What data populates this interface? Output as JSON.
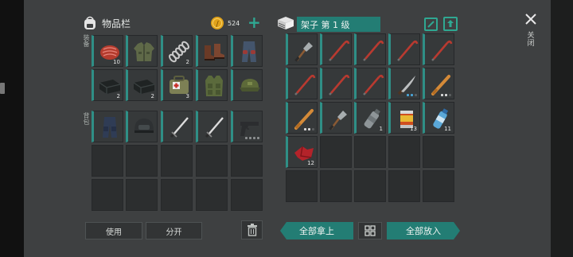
{
  "inventory": {
    "title": "物品栏",
    "coins": "524",
    "add_label": "+",
    "equip_label": "装备",
    "backpack_label": "背包",
    "equip_slots": [
      {
        "item": "raw-meat",
        "count": "10"
      },
      {
        "item": "jacket",
        "count": ""
      },
      {
        "item": "spring",
        "count": "2"
      },
      {
        "item": "boots",
        "count": ""
      },
      {
        "item": "pants",
        "count": ""
      },
      {
        "item": "cloth",
        "count": "2"
      },
      {
        "item": "cloth",
        "count": "2"
      },
      {
        "item": "first-aid-bag",
        "count": "3"
      },
      {
        "item": "vest",
        "count": ""
      },
      {
        "item": "cap",
        "count": ""
      }
    ],
    "backpack_slots": [
      {
        "item": "tactical-pants",
        "count": ""
      },
      {
        "item": "helmet",
        "count": ""
      },
      {
        "item": "katana",
        "count": ""
      },
      {
        "item": "katana",
        "count": ""
      },
      {
        "item": "pistol",
        "count": ""
      }
    ],
    "use_label": "使用",
    "split_label": "分开"
  },
  "storage": {
    "title": "架子 第 1 级",
    "close_label": "关闭",
    "items": [
      {
        "item": "shovel",
        "count": ""
      },
      {
        "item": "crowbar",
        "count": ""
      },
      {
        "item": "crowbar",
        "count": ""
      },
      {
        "item": "crowbar",
        "count": ""
      },
      {
        "item": "crowbar",
        "count": ""
      },
      {
        "item": "crowbar",
        "count": ""
      },
      {
        "item": "crowbar",
        "count": ""
      },
      {
        "item": "crowbar",
        "count": ""
      },
      {
        "item": "machete",
        "count": ""
      },
      {
        "item": "bat",
        "count": ""
      },
      {
        "item": "bat",
        "count": ""
      },
      {
        "item": "shovel",
        "count": ""
      },
      {
        "item": "water-bottle-empty",
        "count": "1"
      },
      {
        "item": "canned-food",
        "count": "13"
      },
      {
        "item": "water-bottle",
        "count": "11"
      },
      {
        "item": "red-cloth",
        "count": "12"
      }
    ],
    "take_all_label": "全部拿上",
    "put_all_label": "全部放入"
  },
  "colors": {
    "accent": "#237d74",
    "coin": "#e0a21a",
    "teal_border": "#2f8f86"
  }
}
